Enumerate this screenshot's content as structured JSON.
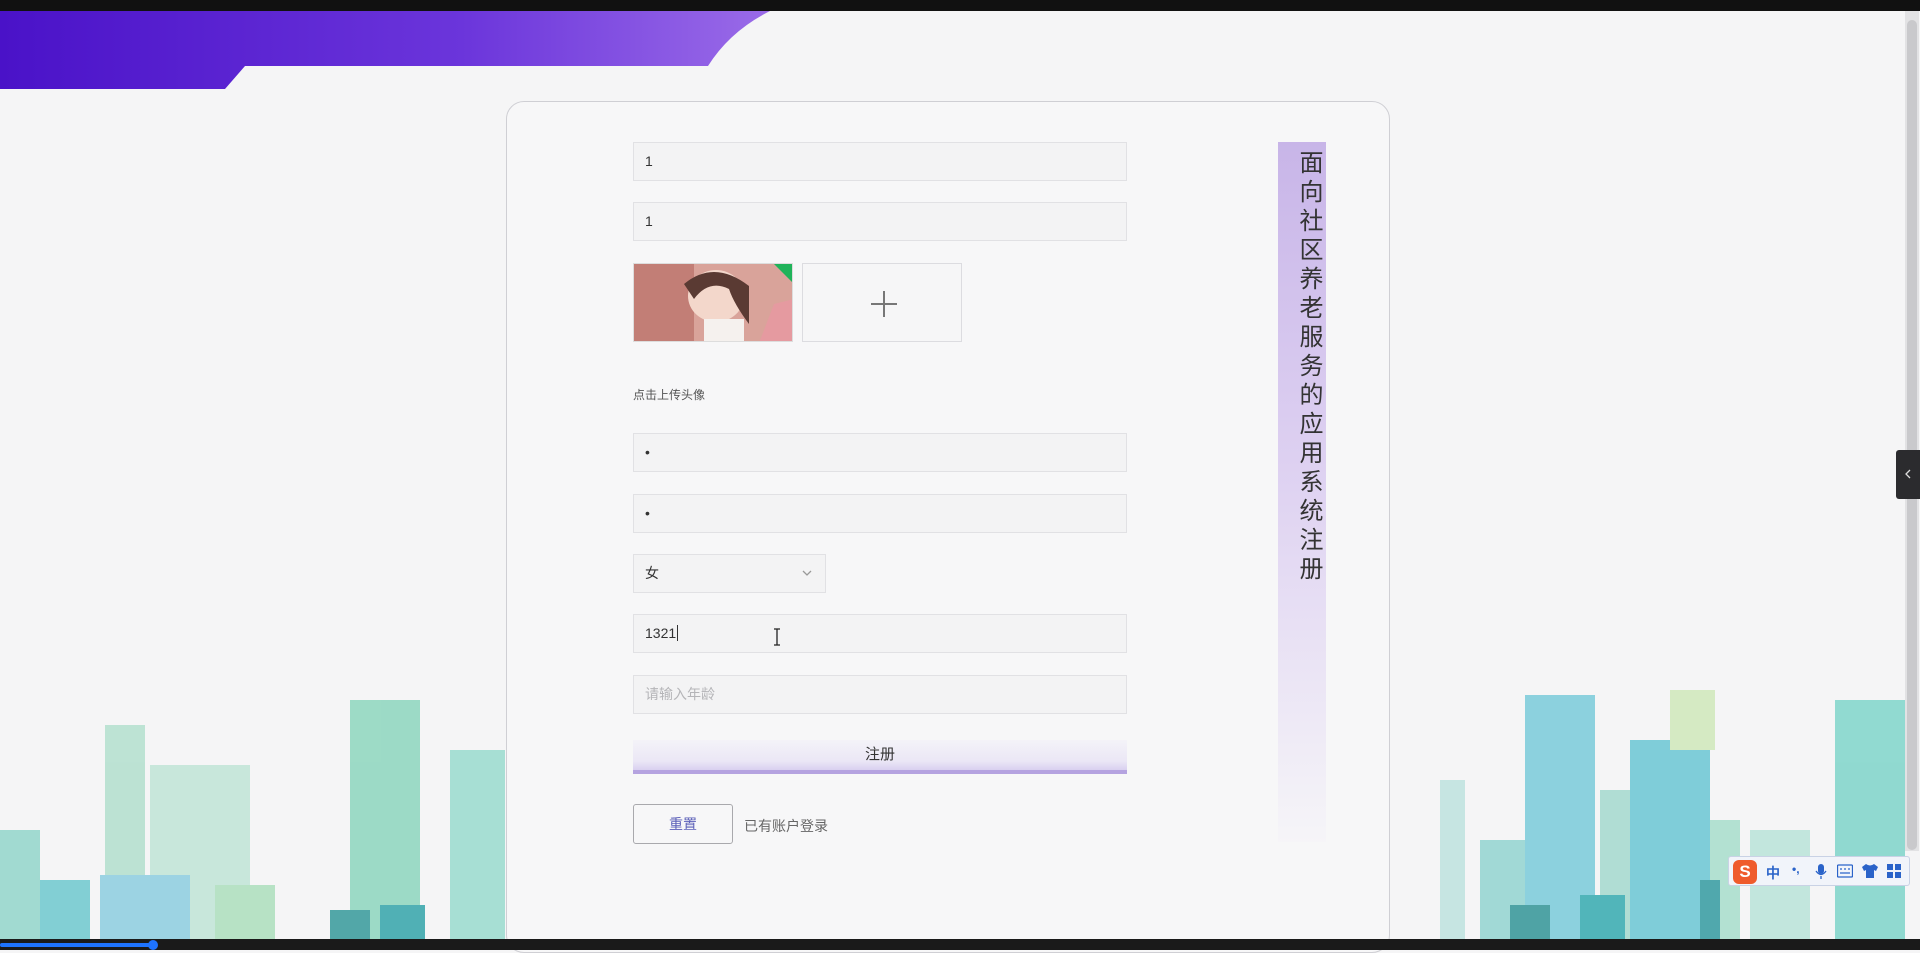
{
  "form": {
    "field1_value": "1",
    "field2_value": "1",
    "avatar_upload_hint": "点击上传头像",
    "password_mask": "•",
    "confirm_password_mask": "•",
    "gender_selected": "女",
    "phone_value": "1321",
    "age_placeholder": "请输入年龄",
    "register_label": "注册",
    "reset_label": "重置",
    "login_link_label": "已有账户登录"
  },
  "title": {
    "text": "面向社区养老服务的应用系统注册"
  },
  "ime": {
    "logo": "S",
    "mode": "中",
    "punct": "•,"
  },
  "colors": {
    "banner_start": "#4a1fd0",
    "banner_end": "#8a55e6",
    "accent_purple": "#b5a3e0",
    "link_blue": "#5b5fb8",
    "skyline_teal": "#5cc8c8"
  }
}
